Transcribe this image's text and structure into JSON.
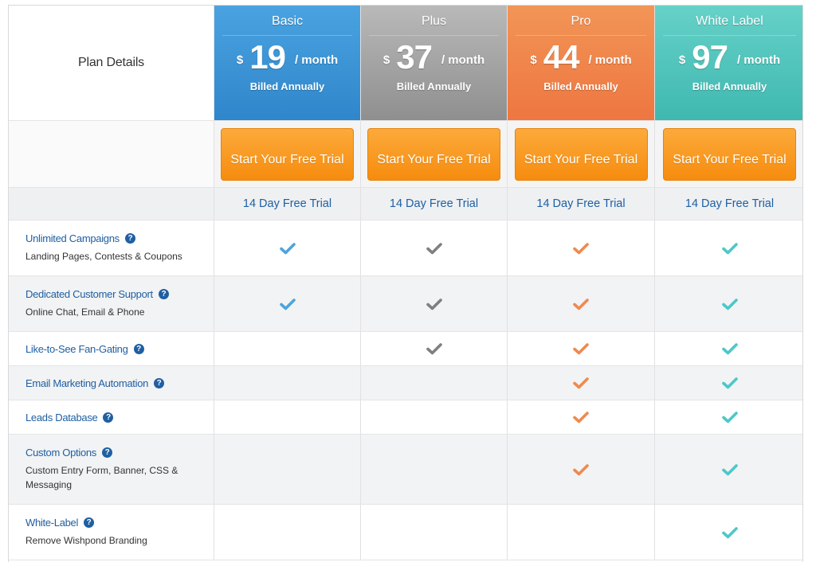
{
  "header": {
    "plan_details_label": "Plan Details"
  },
  "plans": [
    {
      "name": "Basic",
      "currency": "$",
      "price": "19",
      "period": "/ month",
      "billing": "Billed Annually",
      "cta": "Start Your Free Trial",
      "trial": "14 Day Free Trial",
      "color": "#3a93d6",
      "check_color": "#4ea4dc"
    },
    {
      "name": "Plus",
      "currency": "$",
      "price": "37",
      "period": "/ month",
      "billing": "Billed Annually",
      "cta": "Start Your Free Trial",
      "trial": "14 Day Free Trial",
      "color": "#a4a4a4",
      "check_color": "#808080"
    },
    {
      "name": "Pro",
      "currency": "$",
      "price": "44",
      "period": "/ month",
      "billing": "Billed Annually",
      "cta": "Start Your Free Trial",
      "trial": "14 Day Free Trial",
      "color": "#f0834a",
      "check_color": "#ef8a4f"
    },
    {
      "name": "White Label",
      "currency": "$",
      "price": "97",
      "period": "/ month",
      "billing": "Billed Annually",
      "cta": "Start Your Free Trial",
      "trial": "14 Day Free Trial",
      "color": "#52c4bb",
      "check_color": "#4cc8c8"
    }
  ],
  "features": [
    {
      "title": "Unlimited Campaigns",
      "subtitle": "Landing Pages, Contests & Coupons",
      "included": [
        true,
        true,
        true,
        true
      ]
    },
    {
      "title": "Dedicated Customer Support",
      "subtitle": "Online Chat, Email & Phone",
      "included": [
        true,
        true,
        true,
        true
      ]
    },
    {
      "title": "Like-to-See Fan-Gating",
      "subtitle": "",
      "included": [
        false,
        true,
        true,
        true
      ]
    },
    {
      "title": "Email Marketing Automation",
      "subtitle": "",
      "included": [
        false,
        false,
        true,
        true
      ]
    },
    {
      "title": "Leads Database",
      "subtitle": "",
      "included": [
        false,
        false,
        true,
        true
      ]
    },
    {
      "title": "Custom Options",
      "subtitle": "Custom Entry Form, Banner, CSS & Messaging",
      "included": [
        false,
        false,
        true,
        true
      ]
    },
    {
      "title": "White-Label",
      "subtitle": "Remove Wishpond Branding",
      "included": [
        false,
        false,
        false,
        true
      ]
    }
  ],
  "icons": {
    "help": "question-circle-icon",
    "check": "checkmark-icon"
  },
  "help_glyph": "?"
}
